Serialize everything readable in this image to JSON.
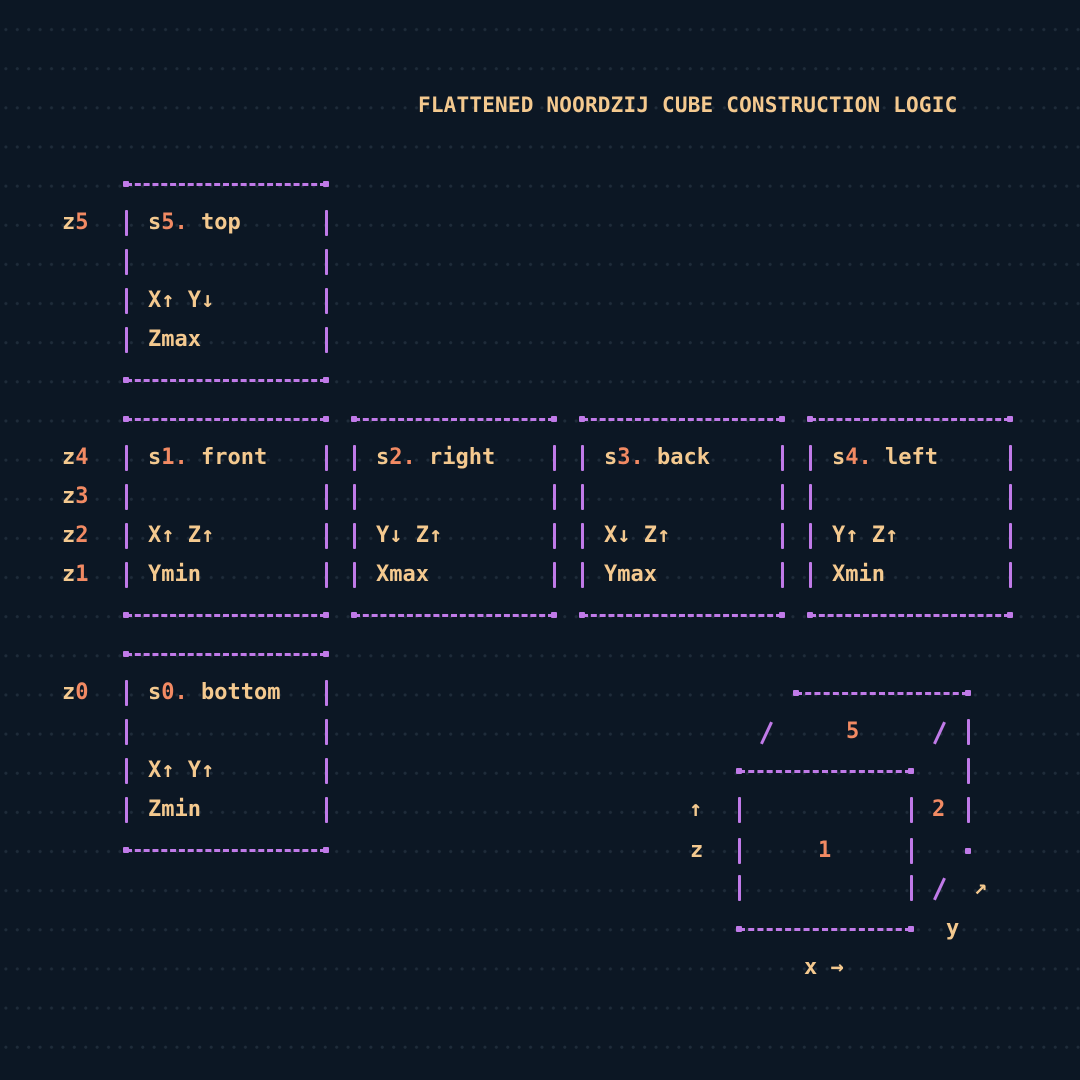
{
  "title": "FLATTENED NOORDZIJ CUBE CONSTRUCTION LOGIC",
  "z_levels": [
    "z5",
    "z4",
    "z3",
    "z2",
    "z1",
    "z0"
  ],
  "faces": {
    "top": {
      "prefix": "s",
      "num": "5",
      "sep": ".",
      "name": "top",
      "axes": "X↑ Y↓",
      "plane": "Zmax"
    },
    "front": {
      "prefix": "s",
      "num": "1",
      "sep": ".",
      "name": "front",
      "axes": "X↑ Z↑",
      "plane": "Ymin"
    },
    "right": {
      "prefix": "s",
      "num": "2",
      "sep": ".",
      "name": "right",
      "axes": "Y↓ Z↑",
      "plane": "Xmax"
    },
    "back": {
      "prefix": "s",
      "num": "3",
      "sep": ".",
      "name": "back",
      "axes": "X↓ Z↑",
      "plane": "Ymax"
    },
    "left": {
      "prefix": "s",
      "num": "4",
      "sep": ".",
      "name": "left",
      "axes": "Y↑ Z↑",
      "plane": "Xmin"
    },
    "bottom": {
      "prefix": "s",
      "num": "0",
      "sep": ".",
      "name": "bottom",
      "axes": "X↑ Y↑",
      "plane": "Zmin"
    }
  },
  "cube": {
    "face_top": "5",
    "face_right": "2",
    "face_front": "1",
    "axis_z": "z",
    "axis_z_arrow": "↑",
    "axis_x": "x →",
    "axis_y": "y",
    "axis_y_arrow": "↗"
  },
  "colors": {
    "background": "#0c1724",
    "text": "#f4c98f",
    "accent": "#f28a63",
    "lines": "#c07ae8"
  }
}
